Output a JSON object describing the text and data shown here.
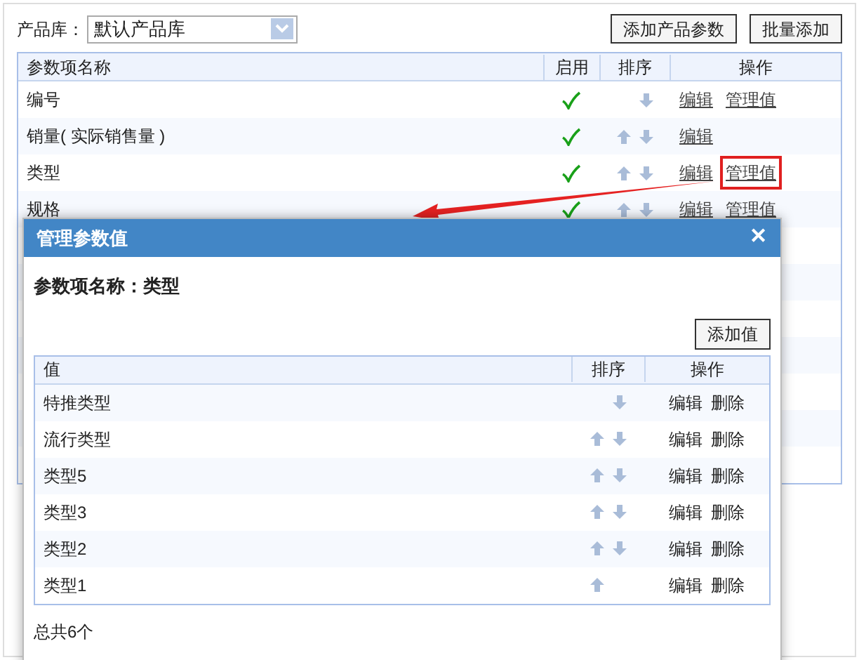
{
  "toolbar": {
    "library_label": "产品库：",
    "library_value": "默认产品库",
    "buttons": [
      "添加产品参数",
      "批量添加"
    ]
  },
  "table": {
    "columns": [
      "参数项名称",
      "启用",
      "排序",
      "操作"
    ],
    "rows": [
      {
        "name": "编号",
        "enabled": true,
        "sort_up": false,
        "sort_down": true,
        "actions": [
          {
            "label": "编辑",
            "highlighted": false
          },
          {
            "label": "管理值",
            "highlighted": false
          }
        ]
      },
      {
        "name": "销量( 实际销售量 )",
        "enabled": true,
        "sort_up": true,
        "sort_down": true,
        "actions": [
          {
            "label": "编辑",
            "highlighted": false
          }
        ]
      },
      {
        "name": "类型",
        "enabled": true,
        "sort_up": true,
        "sort_down": true,
        "actions": [
          {
            "label": "编辑",
            "highlighted": false
          },
          {
            "label": "管理值",
            "highlighted": true
          }
        ]
      },
      {
        "name": "规格",
        "enabled": true,
        "sort_up": true,
        "sort_down": true,
        "actions": [
          {
            "label": "编辑",
            "highlighted": false
          },
          {
            "label": "管理值",
            "highlighted": false
          }
        ]
      }
    ]
  },
  "dialog": {
    "title": "管理参数值",
    "close": "✕",
    "heading": "参数项名称：类型",
    "add_button": "添加值",
    "columns": [
      "值",
      "排序",
      "操作"
    ],
    "rows": [
      {
        "value": "特推类型",
        "sort_up": false,
        "sort_down": true,
        "actions": [
          "编辑",
          "删除"
        ]
      },
      {
        "value": "流行类型",
        "sort_up": true,
        "sort_down": true,
        "actions": [
          "编辑",
          "删除"
        ]
      },
      {
        "value": "类型5",
        "sort_up": true,
        "sort_down": true,
        "actions": [
          "编辑",
          "删除"
        ]
      },
      {
        "value": "类型3",
        "sort_up": true,
        "sort_down": true,
        "actions": [
          "编辑",
          "删除"
        ]
      },
      {
        "value": "类型2",
        "sort_up": true,
        "sort_down": true,
        "actions": [
          "编辑",
          "删除"
        ]
      },
      {
        "value": "类型1",
        "sort_up": true,
        "sort_down": false,
        "actions": [
          "编辑",
          "删除"
        ]
      }
    ],
    "total": "总共6个"
  }
}
